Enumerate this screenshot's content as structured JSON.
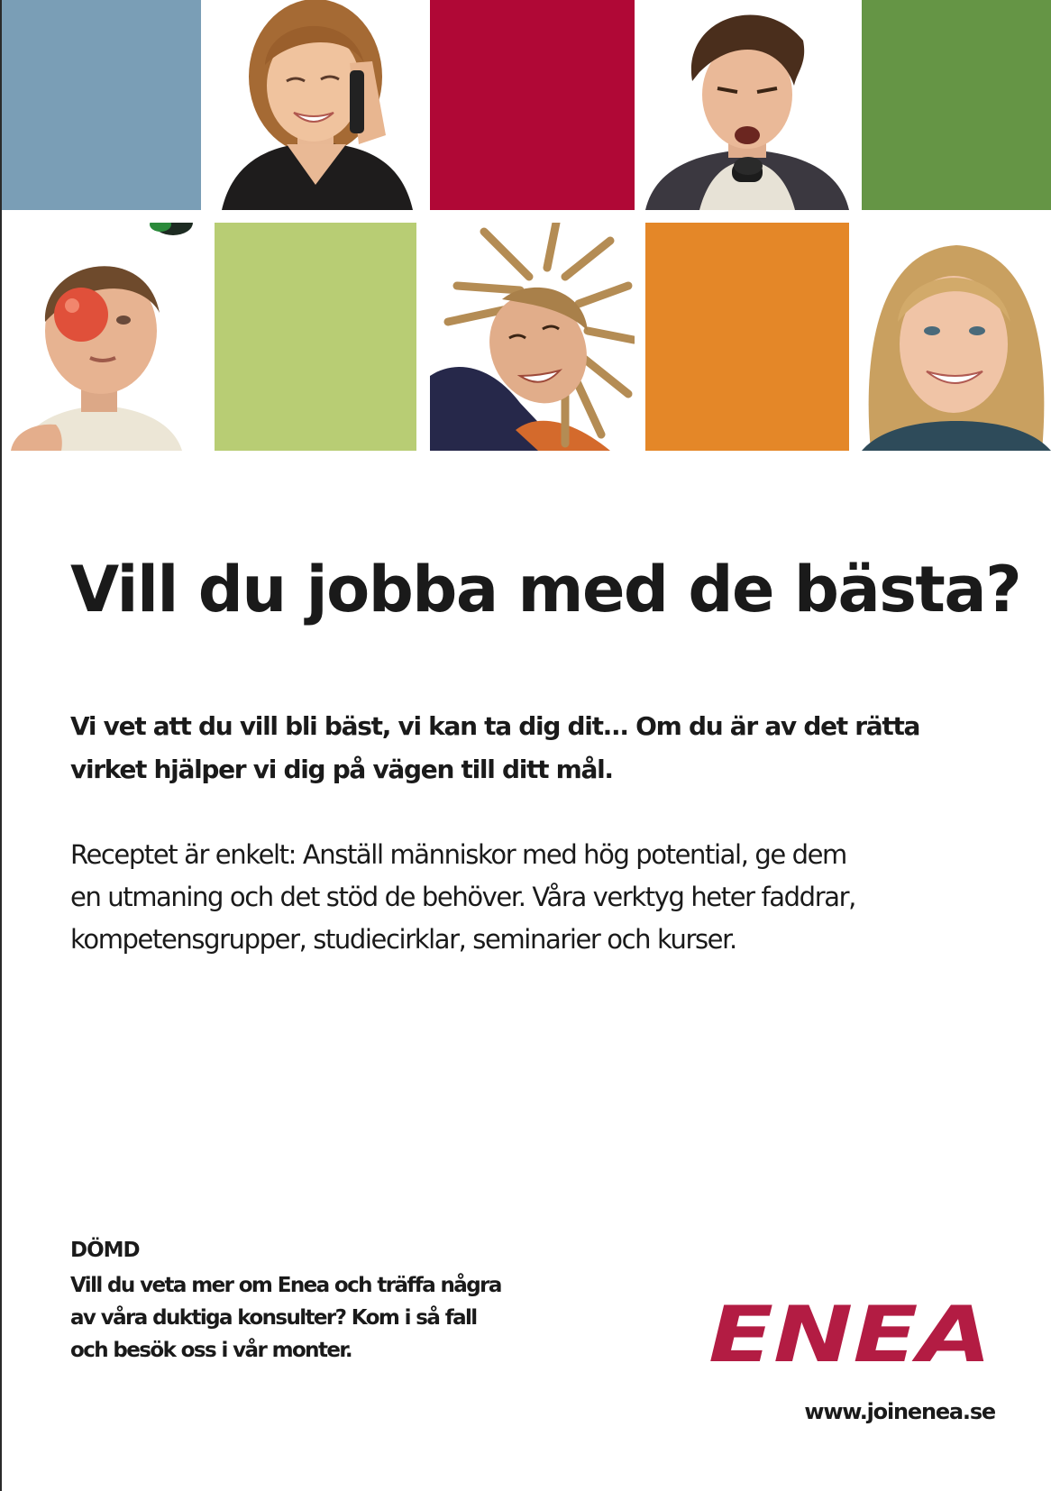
{
  "colors": {
    "blue_tile": "#7a9eb6",
    "red_tile": "#b00836",
    "green_tile": "#659545",
    "light_green_tile": "#b8cd74",
    "orange_tile": "#e48728",
    "brand_red": "#b31c43",
    "text": "#1a1a1a"
  },
  "grid": {
    "tiles": [
      {
        "name": "blue-color-tile",
        "kind": "color",
        "color": "#7a9eb6"
      },
      {
        "name": "photo-woman-on-phone",
        "kind": "photo"
      },
      {
        "name": "red-color-tile",
        "kind": "color",
        "color": "#b00836"
      },
      {
        "name": "photo-man-singing",
        "kind": "photo"
      },
      {
        "name": "green-color-tile",
        "kind": "color",
        "color": "#659545"
      },
      {
        "name": "photo-man-juggling",
        "kind": "photo"
      },
      {
        "name": "light-green-color-tile",
        "kind": "color",
        "color": "#b8cd74"
      },
      {
        "name": "photo-man-dreadlocks",
        "kind": "photo"
      },
      {
        "name": "orange-color-tile",
        "kind": "color",
        "color": "#e48728"
      },
      {
        "name": "photo-woman-smiling",
        "kind": "photo"
      }
    ]
  },
  "ad": {
    "headline": "Vill du jobba med de bästa?",
    "lead_line1": "Vi vet att du vill bli bäst, vi kan ta dig dit... Om du är av det rätta",
    "lead_line2": "virket hjälper vi dig på vägen till ditt mål.",
    "body_line1": "Receptet är enkelt: Anställ människor med hög potential, ge dem",
    "body_line2": "en utmaning och det stöd de behöver. Våra verktyg heter faddrar,",
    "body_line3": "kompetensgrupper, studiecirklar, seminarier och kurser.",
    "booth_heading": "DÖMD",
    "booth_line1": "Vill du veta mer om Enea och träffa några",
    "booth_line2": "av våra duktiga konsulter? Kom i så fall",
    "booth_line3": "och besök oss i vår monter.",
    "logo_text": "ENEA",
    "url": "www.joinenea.se"
  }
}
